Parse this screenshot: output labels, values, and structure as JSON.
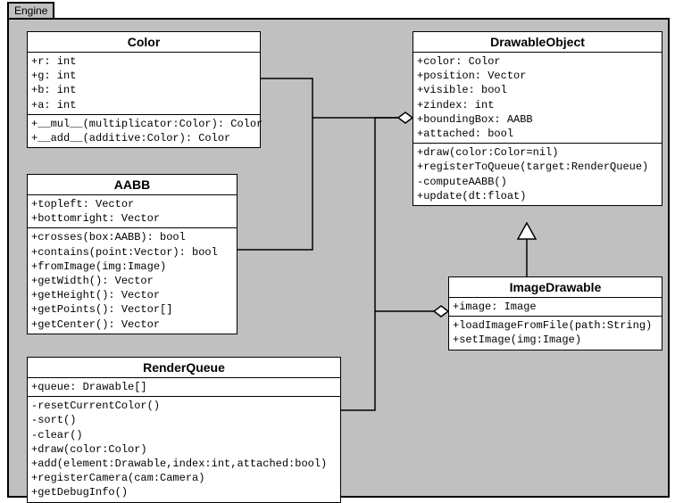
{
  "package": {
    "name": "Engine"
  },
  "classes": {
    "Color": {
      "name": "Color",
      "attrs": "+r: int\n+g: int\n+b: int\n+a: int",
      "ops": "+__mul__(multiplicator:Color): Color\n+__add__(additive:Color): Color"
    },
    "AABB": {
      "name": "AABB",
      "attrs": "+topleft: Vector\n+bottomright: Vector",
      "ops": "+crosses(box:AABB): bool\n+contains(point:Vector): bool\n+fromImage(img:Image)\n+getWidth(): Vector\n+getHeight(): Vector\n+getPoints(): Vector[]\n+getCenter(): Vector"
    },
    "RenderQueue": {
      "name": "RenderQueue",
      "attrs": "+queue: Drawable[]",
      "ops": "-resetCurrentColor()\n-sort()\n-clear()\n+draw(color:Color)\n+add(element:Drawable,index:int,attached:bool)\n+registerCamera(cam:Camera)\n+getDebugInfo()"
    },
    "DrawableObject": {
      "name": "DrawableObject",
      "attrs": "+color: Color\n+position: Vector\n+visible: bool\n+zindex: int\n+boundingBox: AABB\n+attached: bool",
      "ops": "+draw(color:Color=nil)\n+registerToQueue(target:RenderQueue)\n-computeAABB()\n+update(dt:float)"
    },
    "ImageDrawable": {
      "name": "ImageDrawable",
      "attrs": "+image: Image",
      "ops": "+loadImageFromFile(path:String)\n+setImage(img:Image)"
    }
  }
}
